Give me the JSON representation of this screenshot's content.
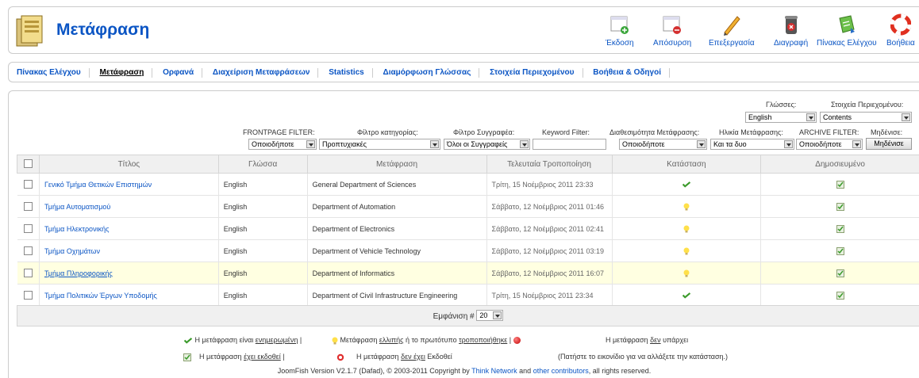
{
  "header": {
    "title": "Μετάφραση",
    "toolbar": [
      {
        "label": "Έκδοση",
        "icon": "publish-icon"
      },
      {
        "label": "Απόσυρση",
        "icon": "unpublish-icon"
      },
      {
        "label": "Επεξεργασία",
        "icon": "edit-icon"
      },
      {
        "label": "Διαγραφή",
        "icon": "trash-icon"
      },
      {
        "label": "Πίνακας Ελέγχου",
        "icon": "control-panel-icon"
      },
      {
        "label": "Βοήθεια",
        "icon": "help-icon"
      }
    ]
  },
  "submenu": [
    {
      "label": "Πίνακας Ελέγχου",
      "active": false
    },
    {
      "label": "Μετάφραση",
      "active": true
    },
    {
      "label": "Ορφανά",
      "active": false
    },
    {
      "label": "Διαχείριση Μεταφράσεων",
      "active": false
    },
    {
      "label": "Statistics",
      "active": false
    },
    {
      "label": "Διαμόρφωση Γλώσσας",
      "active": false
    },
    {
      "label": "Στοιχεία Περιεχομένου",
      "active": false
    },
    {
      "label": "Βοήθεια & Οδηγοί",
      "active": false
    }
  ],
  "filters": {
    "languages_label": "Γλώσσες:",
    "languages_value": "English",
    "content_label": "Στοιχεία Περιεχομένου:",
    "content_value": "Contents",
    "frontpage_label": "FRONTPAGE FILTER:",
    "frontpage_value": "Οποιοδήποτε",
    "category_label": "Φίλτρο κατηγορίας:",
    "category_value": "Προπτυχιακές",
    "author_label": "Φίλτρο Συγγραφέα:",
    "author_value": "Όλοι οι Συγγραφείς",
    "keyword_label": "Keyword Filter:",
    "keyword_value": "",
    "availability_label": "Διαθεσιμότητα Μετάφρασης:",
    "availability_value": "Οποιοδήποτε",
    "age_label": "Ηλικία Μετάφρασης:",
    "age_value": "Και τα δυο",
    "archive_label": "ARCHIVE FILTER:",
    "archive_value": "Οποιοδήποτε",
    "reset_label": "Μηδένισε:",
    "reset_button": "Μηδένισε"
  },
  "table": {
    "headers": [
      "Τίτλος",
      "Γλώσσα",
      "Μετάφραση",
      "Τελευταία Τροποποίηση",
      "Κατάσταση",
      "Δημοσιευμένο"
    ],
    "rows": [
      {
        "title": "Γενικό Τμήμα Θετικών Επιστημών",
        "language": "English",
        "translation": "General Department of Sciences",
        "modified": "Τρίτη, 15 Νοέμβριος 2011 23:33",
        "status": "up-to-date",
        "published": true,
        "highlight": false
      },
      {
        "title": "Τμήμα Αυτοματισμού",
        "language": "English",
        "translation": "Department of Automation",
        "modified": "Σάββατο, 12 Νοέμβριος 2011 01:46",
        "status": "outdated",
        "published": true,
        "highlight": false
      },
      {
        "title": "Τμήμα Ηλεκτρονικής",
        "language": "English",
        "translation": "Department of Electronics",
        "modified": "Σάββατο, 12 Νοέμβριος 2011 02:41",
        "status": "outdated",
        "published": true,
        "highlight": false
      },
      {
        "title": "Τμήμα Οχημάτων",
        "language": "English",
        "translation": "Department of Vehicle Technology",
        "modified": "Σάββατο, 12 Νοέμβριος 2011 03:19",
        "status": "outdated",
        "published": true,
        "highlight": false
      },
      {
        "title": "Τμήμα Πληροφορικής",
        "language": "English",
        "translation": "Department of Informatics",
        "modified": "Σάββατο, 12 Νοέμβριος 2011 16:07",
        "status": "outdated",
        "published": true,
        "highlight": true
      },
      {
        "title": "Τμήμα Πολιτικών Έργων Υποδομής",
        "language": "English",
        "translation": "Department of Civil Infrastructure Engineering",
        "modified": "Τρίτη, 15 Νοέμβριος 2011 23:34",
        "status": "up-to-date",
        "published": true,
        "highlight": false
      }
    ]
  },
  "pager": {
    "label": "Εμφάνιση #",
    "value": "20"
  },
  "legend": {
    "l1a": "Η μετάφραση είναι ",
    "l1a_u": "ενημερωμένη",
    "l1b": "Μετάφραση ",
    "l1b_u": "ελλιπής",
    "l1b_mid": " ή το πρωτότυπο ",
    "l1b_u2": "τροποποιήθηκε",
    "l1c": "Η μετάφραση ",
    "l1c_u": "δεν",
    "l1c_end": " υπάρχει",
    "l2a": "Η μετάφραση ",
    "l2a_u": "έχει εκδοθεί",
    "l2b": "Η μετάφραση ",
    "l2b_u": "δεν έχει",
    "l2b_end": " Εκδοθεί",
    "l2c": "(Πατήστε το εικονίδιο για να αλλάξετε την κατάσταση.)"
  },
  "copyright": {
    "pre": "JoomFish Version V2.1.7 (Dafad), © 2003-2011 Copyright by ",
    "link1": "Think Network",
    "mid": " and ",
    "link2": "other contributors",
    "post": ", all rights reserved."
  }
}
